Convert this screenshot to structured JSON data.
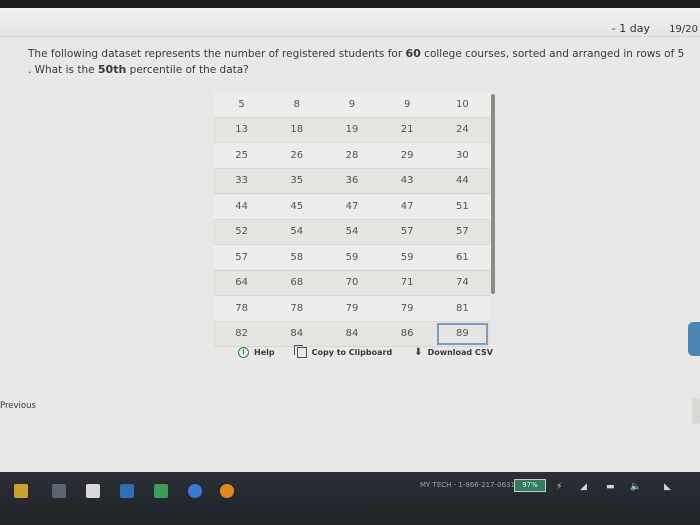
{
  "header": {
    "due": "- 1 day",
    "score": "19/20"
  },
  "question": {
    "part1": "The following dataset represents the number of registered students for ",
    "count": "60",
    "part2": " college courses, sorted and arranged in rows of 5",
    "part3": ". What is the ",
    "percentile": "50th",
    "part4": " percentile of the data?"
  },
  "table": {
    "rows": [
      [
        "5",
        "8",
        "9",
        "9",
        "10"
      ],
      [
        "13",
        "18",
        "19",
        "21",
        "24"
      ],
      [
        "25",
        "26",
        "28",
        "29",
        "30"
      ],
      [
        "33",
        "35",
        "36",
        "43",
        "44"
      ],
      [
        "44",
        "45",
        "47",
        "47",
        "51"
      ],
      [
        "52",
        "54",
        "54",
        "57",
        "57"
      ],
      [
        "57",
        "58",
        "59",
        "59",
        "61"
      ],
      [
        "64",
        "68",
        "70",
        "71",
        "74"
      ],
      [
        "78",
        "78",
        "79",
        "79",
        "81"
      ],
      [
        "82",
        "84",
        "84",
        "86",
        "89"
      ]
    ]
  },
  "actions": {
    "help": "Help",
    "copy": "Copy to Clipboard",
    "download": "Download CSV"
  },
  "nav": {
    "previous": "Previous"
  },
  "taskbar": {
    "support": "MY TECH - 1-866-217-0631",
    "battery": "97%"
  },
  "colors": {
    "help_icon": "#2d8a4f",
    "selected_cell_outline": "#7a9fc4",
    "right_tab": "#4a86b5"
  }
}
